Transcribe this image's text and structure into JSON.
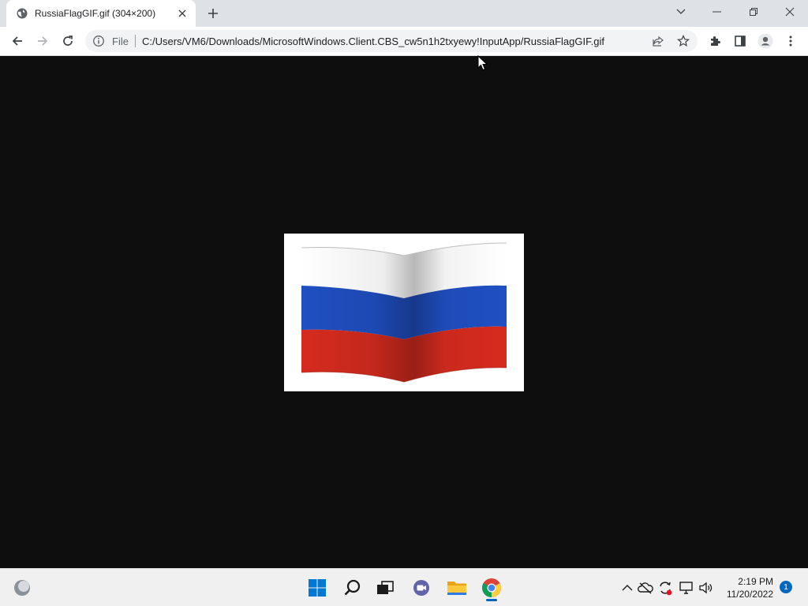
{
  "browser": {
    "tab": {
      "title": "RussiaFlagGIF.gif (304×200)",
      "favicon": "globe-icon"
    },
    "toolbar": {
      "scheme_label": "File",
      "url": "C:/Users/VM6/Downloads/MicrosoftWindows.Client.CBS_cw5n1h2txyewy!InputApp/RussiaFlagGIF.gif"
    },
    "window_controls": [
      "chevron-down-icon",
      "minimize-icon",
      "restore-icon",
      "close-icon"
    ]
  },
  "content": {
    "image": {
      "description": "russia-flag",
      "colors": {
        "white": "#ffffff",
        "blue": "#1f4fc2",
        "red": "#d52b1e"
      },
      "background": "#0e0e0e"
    }
  },
  "taskbar": {
    "pinned": [
      "widgets-icon",
      "start-icon",
      "search-icon",
      "task-view-icon",
      "teams-chat-icon",
      "file-explorer-icon",
      "chrome-icon"
    ],
    "tray": [
      "chevron-up-icon",
      "onedrive-icon",
      "sync-icon",
      "network-icon",
      "volume-icon"
    ],
    "clock": {
      "time": "2:19 PM",
      "date": "11/20/2022"
    },
    "notification_count": "1",
    "accent": "#0067c0"
  }
}
